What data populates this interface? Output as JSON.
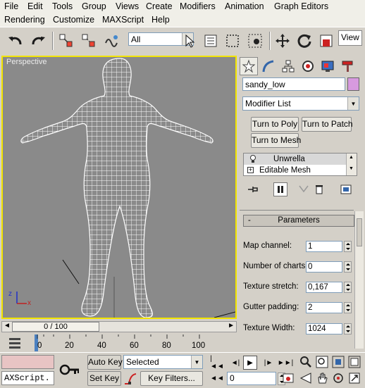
{
  "menubar": {
    "row1": [
      "File",
      "Edit",
      "Tools",
      "Group",
      "Views",
      "Create",
      "Modifiers",
      "Animation",
      "Graph Editors"
    ],
    "row2": [
      "Rendering",
      "Customize",
      "MAXScript",
      "Help"
    ]
  },
  "toolbar": {
    "selection_filter": "All",
    "view_label": "View"
  },
  "viewport": {
    "label": "Perspective",
    "axis_x": "x",
    "axis_z": "z"
  },
  "command_panel": {
    "object_name": "sandy_low",
    "object_color": "#d79adf",
    "modifier_list": "Modifier List",
    "buttons": {
      "turn_to_poly": "Turn to Poly",
      "turn_to_patch": "Turn to Patch",
      "turn_to_mesh": "Turn to Mesh"
    },
    "stack": [
      "Unwrella",
      "Editable Mesh"
    ],
    "rollout": {
      "collapse": "-",
      "title": "Parameters",
      "params": [
        {
          "label": "Map channel:",
          "value": "1"
        },
        {
          "label": "Number of charts:",
          "value": "0"
        },
        {
          "label": "Texture stretch:",
          "value": "0,167"
        },
        {
          "label": "Gutter padding:",
          "value": "2"
        },
        {
          "label": "Texture Width:",
          "value": "1024"
        }
      ]
    }
  },
  "timeline": {
    "slider_label": "0 / 100",
    "ticks": [
      "0",
      "20",
      "40",
      "60",
      "80",
      "100"
    ]
  },
  "bottom": {
    "maxscript_text": "AXScript.",
    "auto_key": "Auto Key",
    "set_key": "Set Key",
    "selected": "Selected",
    "key_filters": "Key Filters...",
    "frame": "0"
  }
}
